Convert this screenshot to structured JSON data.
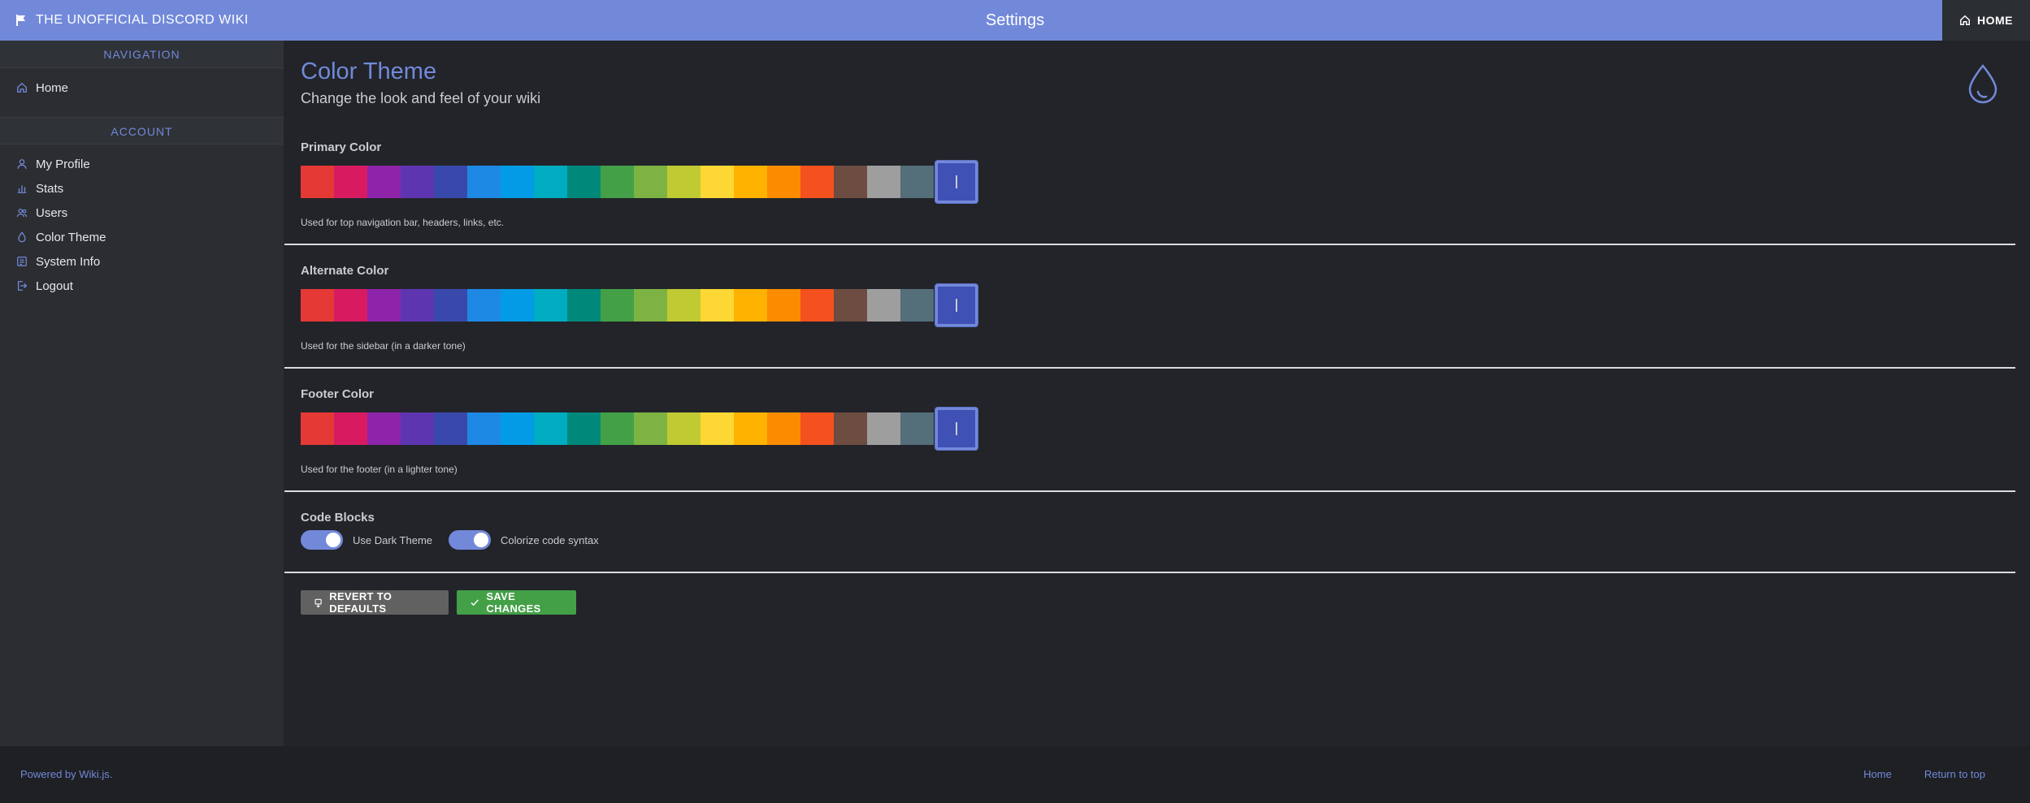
{
  "topbar": {
    "brand": "THE UNOFFICIAL DISCORD WIKI",
    "title": "Settings",
    "home_label": "HOME",
    "color": "#7289da"
  },
  "sidebar": {
    "navigation_header": "NAVIGATION",
    "navigation_items": [
      {
        "label": "Home",
        "icon": "home-icon"
      }
    ],
    "account_header": "ACCOUNT",
    "account_items": [
      {
        "label": "My Profile",
        "icon": "user-icon"
      },
      {
        "label": "Stats",
        "icon": "chart-icon"
      },
      {
        "label": "Users",
        "icon": "users-icon"
      },
      {
        "label": "Color Theme",
        "icon": "drop-icon"
      },
      {
        "label": "System Info",
        "icon": "info-icon"
      },
      {
        "label": "Logout",
        "icon": "logout-icon"
      }
    ]
  },
  "main": {
    "heading": "Color Theme",
    "subheading": "Change the look and feel of your wiki",
    "palette": [
      "#e53935",
      "#d81b60",
      "#8e24aa",
      "#5e35b1",
      "#3949ab",
      "#1e88e5",
      "#039be5",
      "#00acc1",
      "#00897b",
      "#43a047",
      "#7cb342",
      "#c0ca33",
      "#fdd835",
      "#ffb300",
      "#fb8c00",
      "#f4511e",
      "#6d4c41",
      "#9e9e9e",
      "#546e7a"
    ],
    "selected_color": "#3f51b5",
    "primary": {
      "label": "Primary Color",
      "hint": "Used for top navigation bar, headers, links, etc."
    },
    "alternate": {
      "label": "Alternate Color",
      "hint": "Used for the sidebar (in a darker tone)"
    },
    "footer_color": {
      "label": "Footer Color",
      "hint": "Used for the footer (in a lighter tone)"
    },
    "code_blocks": {
      "label": "Code Blocks",
      "dark_theme": "Use Dark Theme",
      "colorize": "Colorize code syntax",
      "dark_theme_on": true,
      "colorize_on": true
    },
    "revert_label": "REVERT TO DEFAULTS",
    "save_label": "SAVE CHANGES"
  },
  "footer": {
    "powered": "Powered by Wiki.js.",
    "home_link": "Home",
    "top_link": "Return to top"
  }
}
